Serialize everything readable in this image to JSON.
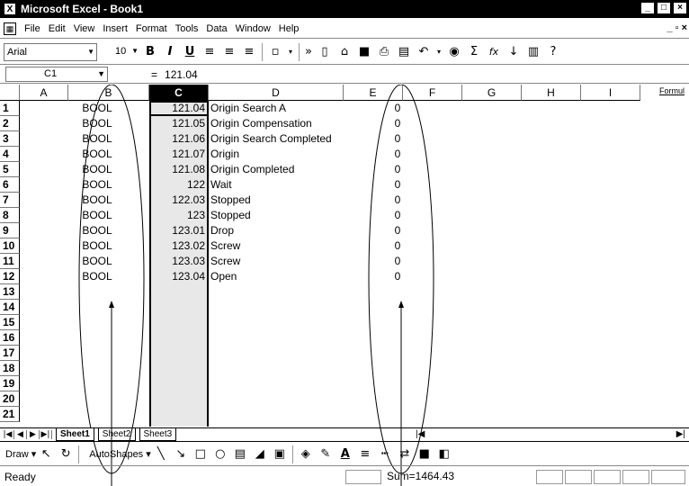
{
  "window": {
    "title": "Microsoft Excel - Book1",
    "buttons": [
      "_",
      "□",
      "×"
    ]
  },
  "menubar": {
    "items": [
      "File",
      "Edit",
      "View",
      "Insert",
      "Format",
      "Tools",
      "Data",
      "Window",
      "Help"
    ],
    "doc_buttons": "_ ▫ ×"
  },
  "toolbar": {
    "font": "Arial",
    "size": "10",
    "bold": "B",
    "italic": "I",
    "underline": "U",
    "autosum": "Σ",
    "function": "fx"
  },
  "formula_bar": {
    "name_box": "C1",
    "equals": "=",
    "value": "121.04"
  },
  "columns": [
    "A",
    "B",
    "C",
    "D",
    "E",
    "F",
    "G",
    "H",
    "I"
  ],
  "formula_side_label": "Formul",
  "rows": [
    {
      "num": "1",
      "b": "BOOL",
      "c": "121.04",
      "d": "Origin Search A",
      "e": "0"
    },
    {
      "num": "2",
      "b": "BOOL",
      "c": "121.05",
      "d": "Origin Compensation",
      "e": "0"
    },
    {
      "num": "3",
      "b": "BOOL",
      "c": "121.06",
      "d": "Origin Search Completed",
      "e": "0"
    },
    {
      "num": "4",
      "b": "BOOL",
      "c": "121.07",
      "d": "Origin",
      "e": "0"
    },
    {
      "num": "5",
      "b": "BOOL",
      "c": "121.08",
      "d": "Origin Completed",
      "e": "0"
    },
    {
      "num": "6",
      "b": "BOOL",
      "c": "122",
      "d": "Wait",
      "e": "0"
    },
    {
      "num": "7",
      "b": "BOOL",
      "c": "122.03",
      "d": "Stopped",
      "e": "0"
    },
    {
      "num": "8",
      "b": "BOOL",
      "c": "123",
      "d": "Stopped",
      "e": "0"
    },
    {
      "num": "9",
      "b": "BOOL",
      "c": "123.01",
      "d": "Drop",
      "e": "0"
    },
    {
      "num": "10",
      "b": "BOOL",
      "c": "123.02",
      "d": "Screw",
      "e": "0"
    },
    {
      "num": "11",
      "b": "BOOL",
      "c": "123.03",
      "d": "Screw",
      "e": "0"
    },
    {
      "num": "12",
      "b": "BOOL",
      "c": "123.04",
      "d": "Open",
      "e": "0"
    },
    {
      "num": "13",
      "b": "",
      "c": "",
      "d": "",
      "e": ""
    },
    {
      "num": "14",
      "b": "",
      "c": "",
      "d": "",
      "e": ""
    },
    {
      "num": "15",
      "b": "",
      "c": "",
      "d": "",
      "e": ""
    },
    {
      "num": "16",
      "b": "",
      "c": "",
      "d": "",
      "e": ""
    },
    {
      "num": "17",
      "b": "",
      "c": "",
      "d": "",
      "e": ""
    },
    {
      "num": "18",
      "b": "",
      "c": "",
      "d": "",
      "e": ""
    },
    {
      "num": "19",
      "b": "",
      "c": "",
      "d": "",
      "e": ""
    },
    {
      "num": "20",
      "b": "",
      "c": "",
      "d": "",
      "e": ""
    },
    {
      "num": "21",
      "b": "",
      "c": "",
      "d": "",
      "e": ""
    }
  ],
  "sheets": [
    "Sheet1",
    "Sheet2",
    "Sheet3"
  ],
  "active_sheet": "Sheet1",
  "drawbar": {
    "draw": "Draw ▾",
    "autoshapes": "AutoShapes ▾"
  },
  "status": {
    "ready": "Ready",
    "sum": "Sum=1464.43"
  }
}
